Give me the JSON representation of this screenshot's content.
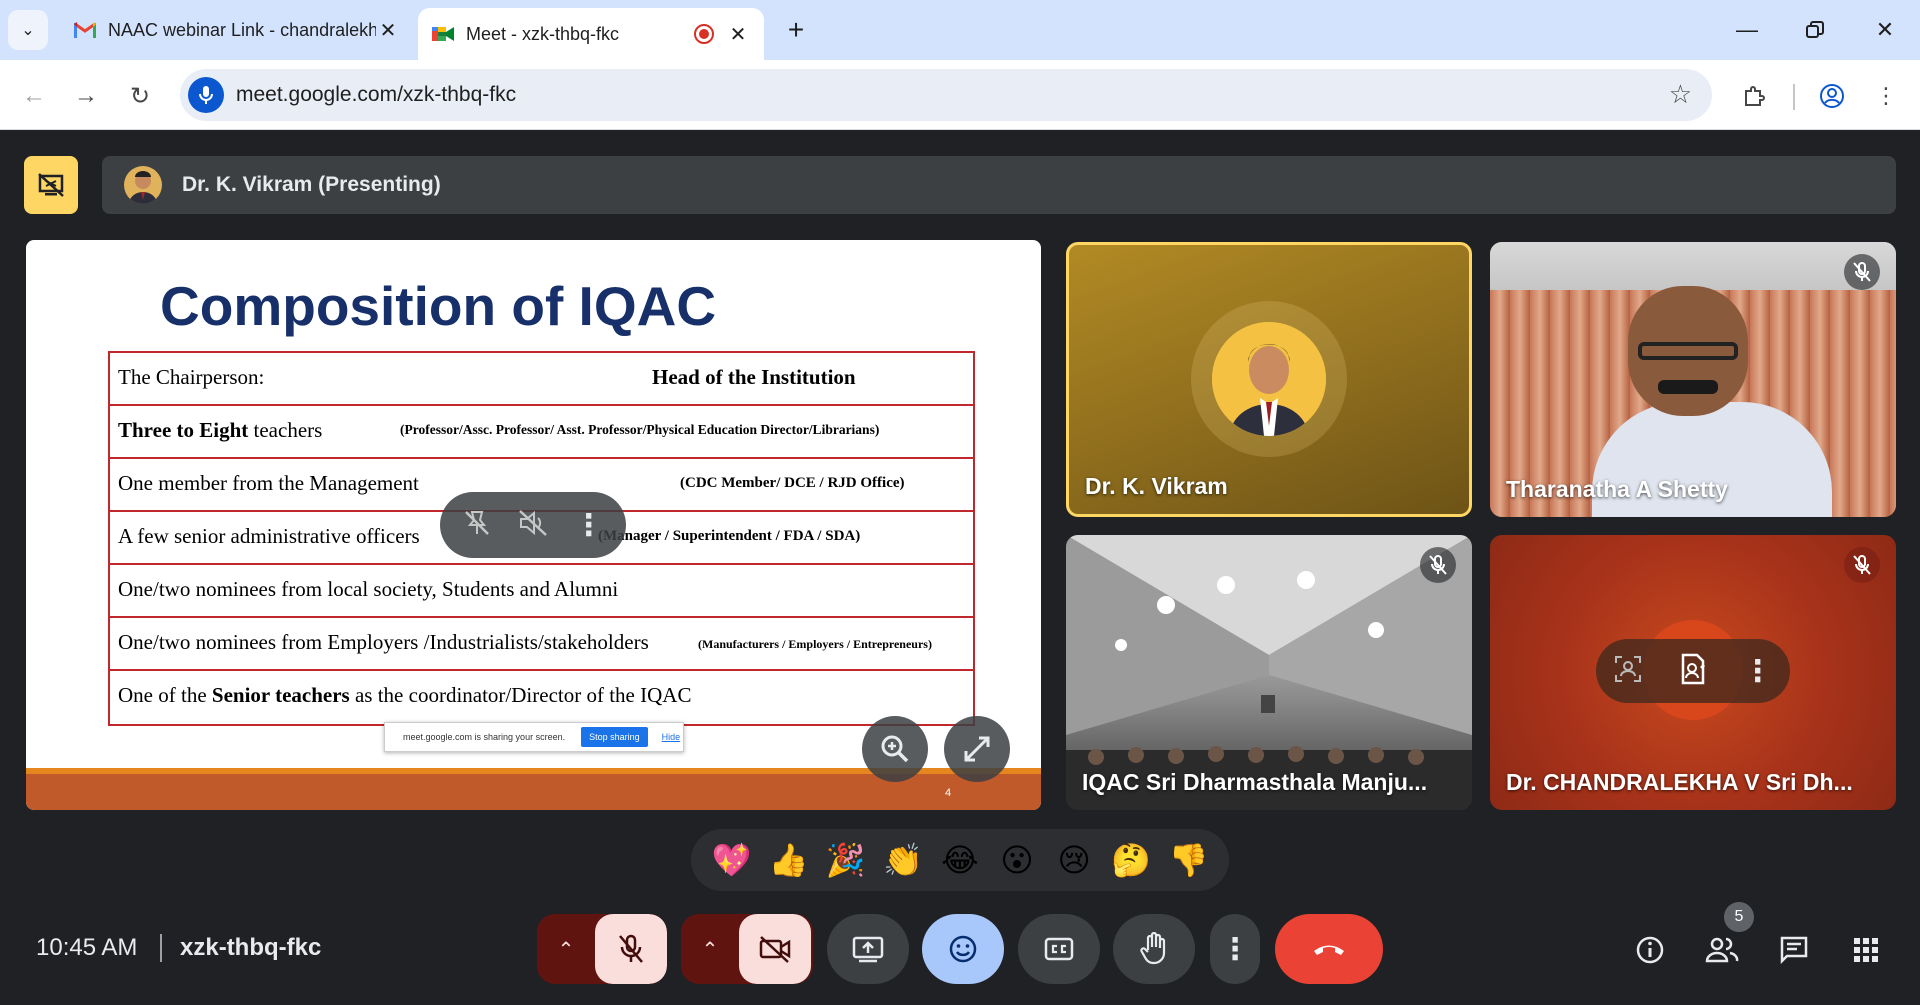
{
  "browser": {
    "tabs": [
      {
        "title": "NAAC webinar Link - chandralekha",
        "icon": "gmail-icon"
      },
      {
        "title": "Meet - xzk-thbq-fkc",
        "icon": "google-meet-icon",
        "recording": true
      }
    ],
    "url": "meet.google.com/xzk-thbq-fkc"
  },
  "presenting": {
    "label": "Dr. K. Vikram (Presenting)"
  },
  "slide": {
    "title": "Composition of IQAC",
    "rows": [
      {
        "left": "The Chairperson:",
        "right": "Head of the Institution"
      },
      {
        "left_bold": "Three to Eight",
        "left_rest": " teachers",
        "right": "(Professor/Assc. Professor/ Asst. Professor/Physical Education Director/Librarians)"
      },
      {
        "left": "One member from the Management",
        "right": "(CDC Member/ DCE / RJD Office)"
      },
      {
        "left": "A few senior administrative officers",
        "right": "(Manager / Superintendent / FDA / SDA)"
      },
      {
        "left": "One/two nominees from local society, Students and Alumni",
        "right": ""
      },
      {
        "left": "One/two nominees from Employers /Industrialists/stakeholders",
        "right": "(Manufacturers / Employers / Entrepreneurs)"
      },
      {
        "left_pre": "One of the ",
        "left_bold": "Senior teachers",
        "left_rest": " as the coordinator/Director of the IQAC",
        "right": ""
      }
    ],
    "page_number": "4",
    "share_notice": {
      "text": "meet.google.com is sharing your screen.",
      "stop": "Stop sharing",
      "hide": "Hide"
    }
  },
  "participants": [
    {
      "name": "Dr. K. Vikram",
      "muted": false,
      "speaking": true
    },
    {
      "name": "Tharanatha A Shetty",
      "muted": true
    },
    {
      "name": "IQAC Sri Dharmasthala Manju...",
      "muted": true
    },
    {
      "name": "Dr. CHANDRALEKHA V Sri Dh...",
      "muted": true
    }
  ],
  "reactions": [
    "💖",
    "👍",
    "🎉",
    "👏",
    "😂",
    "😮",
    "😢",
    "🤔",
    "👎"
  ],
  "bottom_bar": {
    "time": "10:45 AM",
    "meeting_code": "xzk-thbq-fkc",
    "people_count": "5"
  },
  "colors": {
    "accent_yellow": "#fdd663",
    "leave_red": "#ea4335",
    "muted_bg": "#f9dedc",
    "reactions_active": "#a8c7fa"
  }
}
